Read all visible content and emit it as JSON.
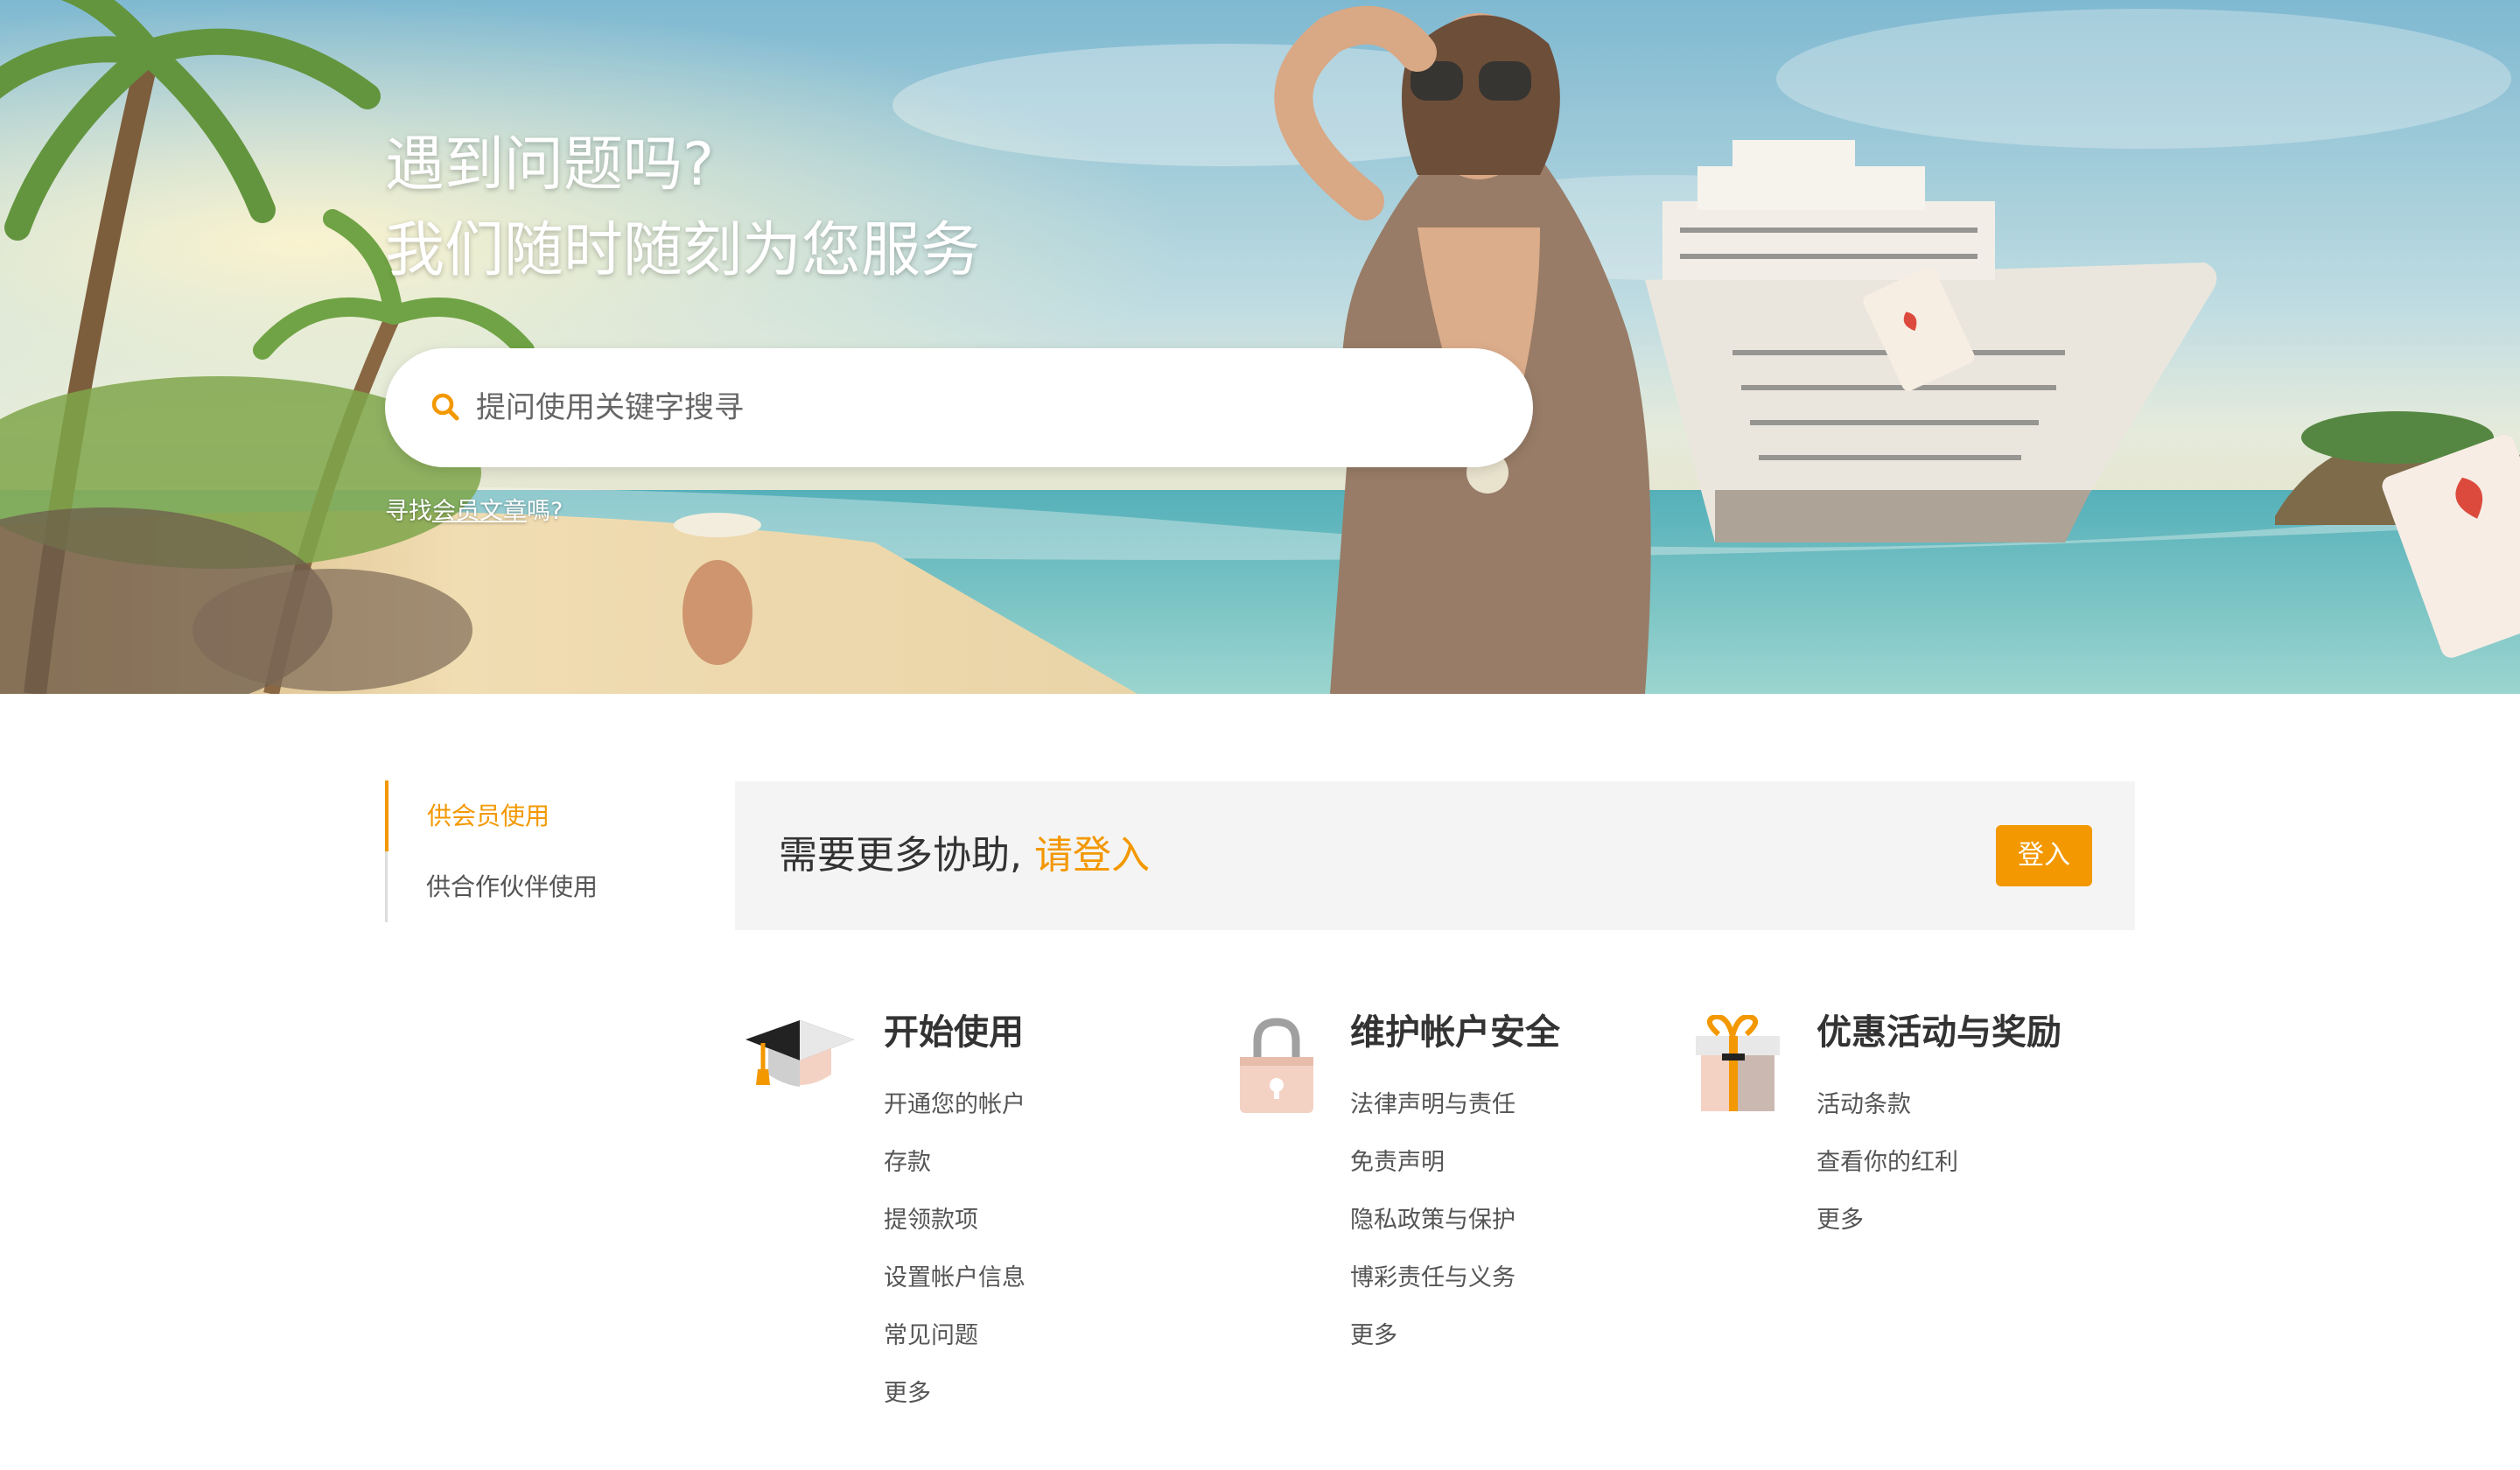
{
  "hero": {
    "title_line1": "遇到问题吗?",
    "title_line2": "我们随时随刻为您服务",
    "search_placeholder": "提问使用关键字搜寻",
    "member_prefix": "寻找",
    "member_link": "会员文章",
    "member_suffix": "嗎?"
  },
  "sidebar": {
    "items": [
      {
        "label": "供会员使用",
        "active": true
      },
      {
        "label": "供合作伙伴使用",
        "active": false
      }
    ]
  },
  "login_banner": {
    "text": "需要更多协助,",
    "link": "请登入",
    "button": "登入"
  },
  "categories": [
    {
      "title": "开始使用",
      "icon": "graduation-cap-icon",
      "links": [
        "开通您的帐户",
        "存款",
        "提领款项",
        "设置帐户信息",
        "常见问题",
        "更多"
      ]
    },
    {
      "title": "维护帐户安全",
      "icon": "padlock-icon",
      "links": [
        "法律声明与责任",
        "免责声明",
        "隐私政策与保护",
        "博彩责任与义务",
        "更多"
      ]
    },
    {
      "title": "优惠活动与奖励",
      "icon": "gift-box-icon",
      "links": [
        "活动条款",
        "查看你的红利",
        "更多"
      ]
    }
  ],
  "colors": {
    "accent": "#f39800",
    "banner_bg": "#f4f4f4",
    "text": "#333333"
  }
}
